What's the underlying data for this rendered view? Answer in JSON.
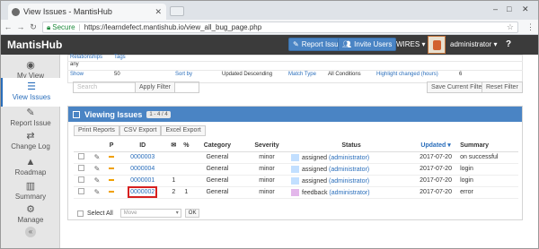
{
  "browser": {
    "tab_title": "View Issues - MantisHub",
    "secure_label": "Secure",
    "url": "https://learndefect.mantishub.io/view_all_bug_page.php"
  },
  "app": {
    "brand": "MantisHub",
    "report_issue": "Report Issue",
    "invite_users": "Invite Users",
    "project": "WIRES",
    "user": "administrator",
    "help": "?"
  },
  "sidebar": {
    "items": [
      {
        "label": "My View",
        "icon": "◉"
      },
      {
        "label": "View Issues",
        "icon": "☰"
      },
      {
        "label": "Report Issue",
        "icon": "✎"
      },
      {
        "label": "Change Log",
        "icon": "⇄"
      },
      {
        "label": "Roadmap",
        "icon": "▲"
      },
      {
        "label": "Summary",
        "icon": "▥"
      },
      {
        "label": "Manage",
        "icon": "⚙"
      }
    ],
    "collapse": "«"
  },
  "filters": {
    "row1": {
      "relationships": "Relationships",
      "tags": "Tags"
    },
    "row2": {
      "any": "any"
    },
    "row3": {
      "show_label": "Show",
      "show_value": "50",
      "sort_label": "Sort by",
      "sort_value": "Updated Descending",
      "match_label": "Match Type",
      "match_value": "All Conditions",
      "highlight_label": "Highlight changed (hours)",
      "highlight_value": "6"
    },
    "search_placeholder": "Search",
    "apply": "Apply Filter",
    "save": "Save Current Filter",
    "reset": "Reset Filter"
  },
  "viewing": {
    "title": "Viewing Issues",
    "range": "1 - 4 / 4",
    "print": "Print Reports",
    "csv": "CSV Export",
    "excel": "Excel Export",
    "columns": [
      "P",
      "ID",
      "✉",
      "%",
      "Category",
      "Severity",
      "Status",
      "Updated ▾",
      "Summary"
    ],
    "rows": [
      {
        "id": "0000003",
        "notes": "",
        "attach": "",
        "category": "General",
        "severity": "minor",
        "status": "assigned",
        "handler": "(administrator)",
        "color": "#c2dfff",
        "updated": "2017-07-20",
        "summary": "on successful"
      },
      {
        "id": "0000004",
        "notes": "",
        "attach": "",
        "category": "General",
        "severity": "minor",
        "status": "assigned",
        "handler": "(administrator)",
        "color": "#c2dfff",
        "updated": "2017-07-20",
        "summary": "login"
      },
      {
        "id": "0000001",
        "notes": "1",
        "attach": "",
        "category": "General",
        "severity": "minor",
        "status": "assigned",
        "handler": "(administrator)",
        "color": "#c2dfff",
        "updated": "2017-07-20",
        "summary": "login"
      },
      {
        "id": "0000002",
        "notes": "2",
        "attach": "1",
        "category": "General",
        "severity": "minor",
        "status": "feedback",
        "handler": "(administrator)",
        "color": "#e3b7eb",
        "updated": "2017-07-20",
        "summary": "error"
      }
    ],
    "select_all": "Select All",
    "move_option": "Move",
    "ok": "OK"
  }
}
